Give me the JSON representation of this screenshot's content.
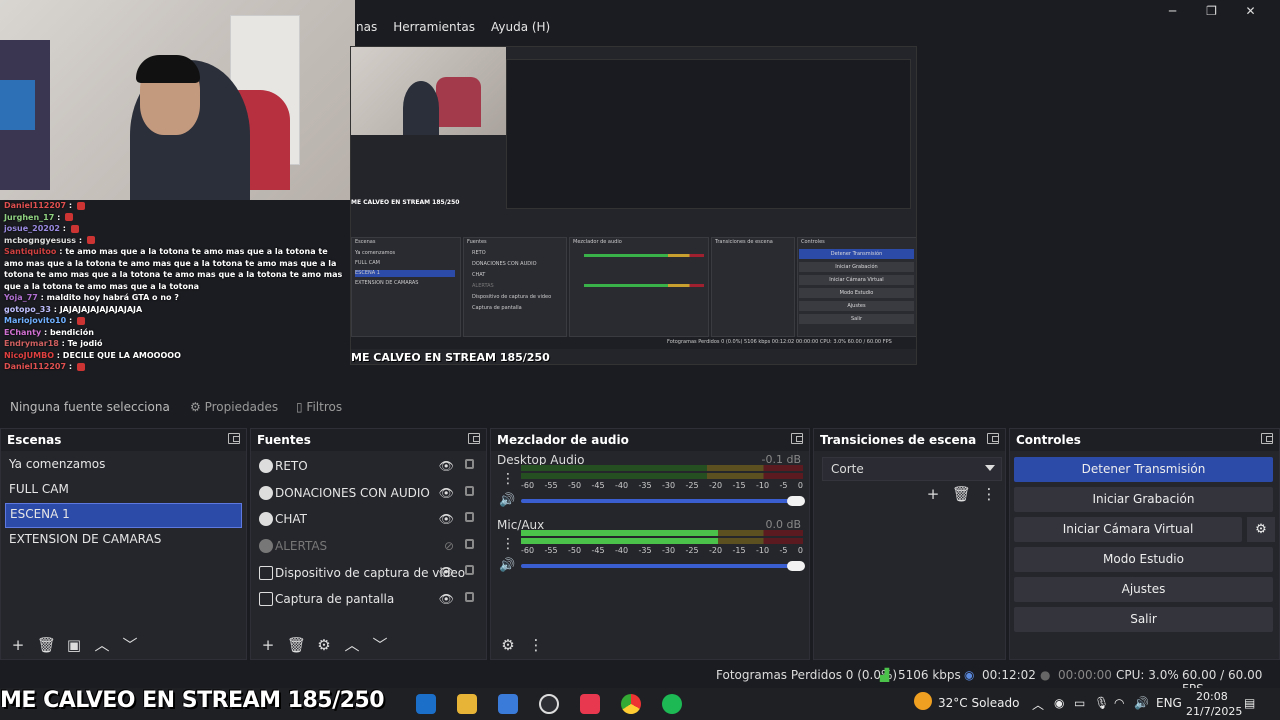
{
  "menu": {
    "items": [
      "nas",
      "Herramientas",
      "Ayuda (H)"
    ]
  },
  "window_controls": {
    "minimize": "─",
    "maximize": "❐",
    "close": "✕"
  },
  "chat": [
    {
      "nick": "Daniel112207",
      "text": "",
      "color": "#e05050"
    },
    {
      "nick": "Jurghen_17",
      "text": "",
      "color": "#8fd080"
    },
    {
      "nick": "josue_20202",
      "text": "",
      "color": "#9a8ae0"
    },
    {
      "nick": "mcbogngyesuss",
      "text": "",
      "color": "#ddd"
    },
    {
      "nick": "Santiquitoo",
      "text": "te amo mas que a la totona te amo mas que a la totona te amo mas que a la totona te amo mas que a la totona te amo mas que a la totona te amo mas que a la totona te amo mas que a la totona te amo mas que a la totona te amo mas que a la totona",
      "color": "#d04040"
    },
    {
      "nick": "Yoja_77",
      "text": "maldito hoy habrá GTA o no ?",
      "color": "#b070d0"
    },
    {
      "nick": "gotopo_33",
      "text": "JAJAJAJAJAJAJAJAJA",
      "color": "#c0c0ff"
    },
    {
      "nick": "Mariojovito10",
      "text": "",
      "color": "#70b0ff"
    },
    {
      "nick": "EChanty",
      "text": "bendición",
      "color": "#d070d0"
    },
    {
      "nick": "Endrymar18",
      "text": "Te jodió",
      "color": "#d06060"
    },
    {
      "nick": "NicoJUMBO",
      "text": "DECILE QUE LA AMOOOOO",
      "color": "#e04040"
    },
    {
      "nick": "Daniel112207",
      "text": "",
      "color": "#e05050"
    }
  ],
  "preview": {
    "overlay_text": "ME CALVEO EN STREAM 185/250",
    "mini_overlay": "ME CALVEO EN STREAM 185/250",
    "mini_panels": [
      "Escenas",
      "Fuentes",
      "Mezclador de audio",
      "Transiciones de escena",
      "Controles"
    ],
    "mini_scenes": [
      "Ya comenzamos",
      "FULL CAM",
      "ESCENA 1",
      "EXTENSION DE CAMARAS"
    ],
    "mini_sources": [
      "RETO",
      "DONACIONES CON AUDIO",
      "CHAT",
      "ALERTAS",
      "Dispositivo de captura de video",
      "Captura de pantalla"
    ],
    "mini_controls": [
      "Detener Transmisión",
      "Iniciar Grabación",
      "Iniciar Cámara Virtual",
      "Modo Estudio",
      "Ajustes",
      "Salir"
    ],
    "mini_status": "Fotogramas Perdidos 0 (0.0%)   5106 kbps   00:12:02   00:00:00   CPU: 3.0%   60.00 / 60.00 FPS"
  },
  "propbar": {
    "no_source": "Ninguna fuente selecciona",
    "properties": "Propiedades",
    "filters": "Filtros"
  },
  "scenes": {
    "title": "Escenas",
    "items": [
      "Ya comenzamos",
      "FULL CAM",
      "ESCENA 1",
      "EXTENSION DE CAMARAS"
    ],
    "selected_index": 2
  },
  "sources": {
    "title": "Fuentes",
    "items": [
      {
        "label": "RETO",
        "icon": "browser-icon",
        "visible": true
      },
      {
        "label": "DONACIONES CON AUDIO",
        "icon": "browser-icon",
        "visible": true
      },
      {
        "label": "CHAT",
        "icon": "browser-icon",
        "visible": true
      },
      {
        "label": "ALERTAS",
        "icon": "browser-icon",
        "visible": false
      },
      {
        "label": "Dispositivo de captura de video",
        "icon": "camera-icon",
        "visible": true
      },
      {
        "label": "Captura de pantalla",
        "icon": "monitor-icon",
        "visible": true
      }
    ]
  },
  "mixer": {
    "title": "Mezclador de audio",
    "ticks": [
      "-60",
      "-55",
      "-50",
      "-45",
      "-40",
      "-35",
      "-30",
      "-25",
      "-20",
      "-15",
      "-10",
      "-5",
      "0"
    ],
    "channels": [
      {
        "name": "Desktop Audio",
        "db": "-0.1 dB",
        "level": 0
      },
      {
        "name": "Mic/Aux",
        "db": "0.0 dB",
        "level": 0.7
      }
    ]
  },
  "transitions": {
    "title": "Transiciones de escena",
    "selected": "Corte"
  },
  "controls": {
    "title": "Controles",
    "stop_stream": "Detener Transmisión",
    "start_recording": "Iniciar Grabación",
    "start_virtual_cam": "Iniciar Cámara Virtual",
    "studio_mode": "Modo Estudio",
    "settings": "Ajustes",
    "exit": "Salir"
  },
  "status": {
    "dropped_frames": "Fotogramas Perdidos 0 (0.0%)",
    "bitrate": "5106 kbps",
    "stream_time": "00:12:02",
    "rec_time": "00:00:00",
    "cpu": "CPU: 3.0%",
    "fps": "60.00 / 60.00 FPS"
  },
  "overlay_big": "ME CALVEO EN STREAM 185/250",
  "taskbar": {
    "weather": "32°C  Soleado",
    "lang": "ENG",
    "time": "20:08",
    "date": "21/7/2025"
  },
  "colors": {
    "accent": "#2c4aa8",
    "meter_green": "#4bc34a",
    "panel_bg": "#25262c"
  }
}
